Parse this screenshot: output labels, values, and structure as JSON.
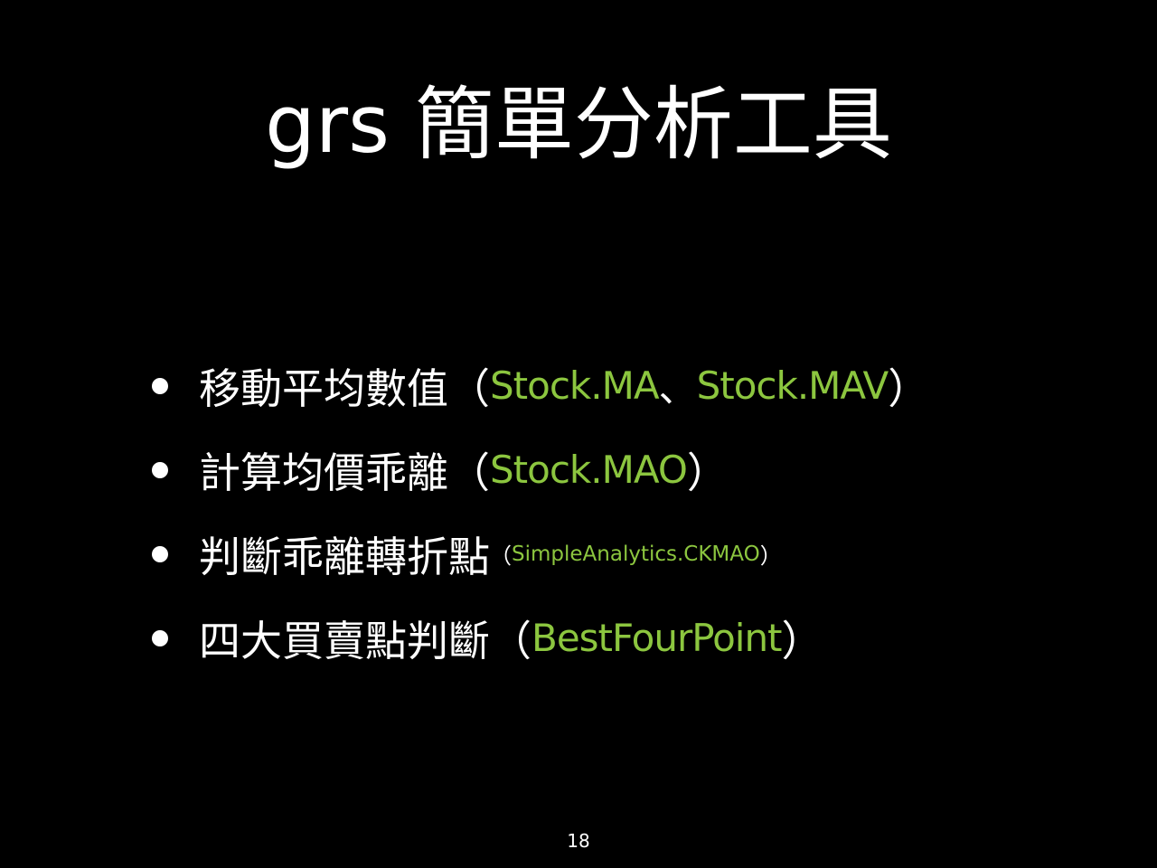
{
  "slide": {
    "title": "grs 簡單分析工具",
    "page_number": "18",
    "accent_color": "#8cc63f",
    "background_color": "#000000",
    "bullets": [
      {
        "text": "移動平均數值",
        "open": "（",
        "code1": "Stock.MA",
        "sep": "、",
        "code2": "Stock.MAV",
        "close": "）"
      },
      {
        "text": "計算均價乖離",
        "open": "（",
        "code1": "Stock.MAO",
        "close": "）"
      },
      {
        "text": "判斷乖離轉折點",
        "open": "（",
        "code1": "SimpleAnalytics.CKMAO",
        "close": "）"
      },
      {
        "text": "四大買賣點判斷",
        "open": "（",
        "code1": "BestFourPoint",
        "close": "）"
      }
    ]
  }
}
